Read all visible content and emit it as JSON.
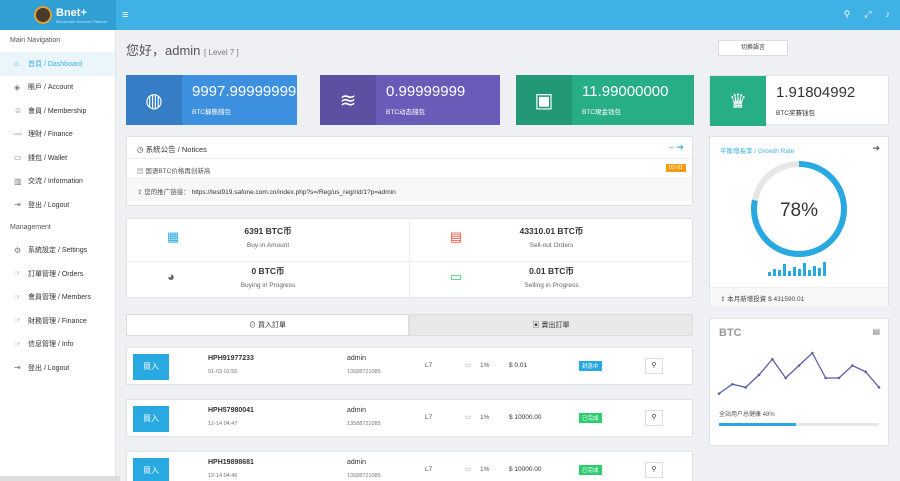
{
  "brand": {
    "name": "Bnet+",
    "subtitle": "Blockchain Network Platform"
  },
  "sidebar": {
    "sections": [
      {
        "title": "Main Navigation",
        "items": [
          {
            "label": "首頁 / Dashboard",
            "icon": "home-icon",
            "active": true
          },
          {
            "label": "賬戶 / Account",
            "icon": "layers-icon"
          },
          {
            "label": "會員 / Membership",
            "icon": "user-icon"
          },
          {
            "label": "理財 / Finance",
            "icon": "trend-icon"
          },
          {
            "label": "錢包 / Wallet",
            "icon": "folder-icon"
          },
          {
            "label": "交流 / Information",
            "icon": "book-icon"
          },
          {
            "label": "登出 / Logout",
            "icon": "logout-icon"
          }
        ]
      },
      {
        "title": "Management",
        "items": [
          {
            "label": "系統設定 / Settings",
            "icon": "settings-icon"
          },
          {
            "label": "訂單管理 / Orders",
            "icon": "hand-icon"
          },
          {
            "label": "會員管理 / Members",
            "icon": "hand-icon"
          },
          {
            "label": "財務管理 / Finance",
            "icon": "hand-icon"
          },
          {
            "label": "信息管理 / Info",
            "icon": "hand-icon"
          },
          {
            "label": "登出 / Logout",
            "icon": "logout-icon"
          }
        ]
      }
    ]
  },
  "header": {
    "greeting": "您好，admin",
    "level": "[ Level 7 ]",
    "switch_label": "切换語言"
  },
  "stats": [
    {
      "value": "9997.99999999",
      "label": "BTC靜態錢包",
      "color": "#3d8fe0",
      "icon": "globe-icon"
    },
    {
      "value": "0.99999999",
      "label": "BTC动态錢包",
      "color": "#6a5bb8",
      "icon": "stack-icon"
    },
    {
      "value": "11.99000000",
      "label": "BTC現金钱包",
      "color": "#27ae87",
      "icon": "wallet-icon"
    },
    {
      "value": "1.91804992",
      "label": "BTC奖賽钱包",
      "color": "#ffffff",
      "icon": "trophy-icon"
    }
  ],
  "notices": {
    "title": "系統公告 / Notices",
    "item": "国语BTC价格再创新高",
    "badge": "02-01",
    "link_label": "您的推广链接：",
    "link_url": "https://test919.safone.com.cn/index.php?s=/Reg/us_reg/rid/1?p=admin"
  },
  "summary": [
    {
      "amount": "6391 BTC币",
      "caption": "Buy-in Amount",
      "icon": "map-icon",
      "color": "#29a9e1"
    },
    {
      "amount": "43310.01 BTC币",
      "caption": "Sell-out Orders",
      "icon": "money-icon",
      "color": "#e74c3c"
    },
    {
      "amount": "0 BTC币",
      "caption": "Buying in Progress",
      "icon": "globe-small-icon",
      "color": "#666666"
    },
    {
      "amount": "0.01 BTC币",
      "caption": "Selling in Progress",
      "icon": "inbox-icon",
      "color": "#2ecc71"
    }
  ],
  "tabs": [
    {
      "label": "買入訂單"
    },
    {
      "label": "賣出訂單"
    }
  ],
  "orders": [
    {
      "button": "買入",
      "id": "HPH91977233",
      "time": "01-03 01:55",
      "user": "admin",
      "phone": "13588721085",
      "level": "L7",
      "pct": "1%",
      "price": "$ 0.01",
      "status": "封息中",
      "status_color": "#29a9e1"
    },
    {
      "button": "買入",
      "id": "HPH57980041",
      "time": "12-14 04:47",
      "user": "admin",
      "phone": "13588721085",
      "level": "L7",
      "pct": "1%",
      "price": "$ 10000.00",
      "status": "已完成",
      "status_color": "#2ecc71"
    },
    {
      "button": "買入",
      "id": "HPH19898681",
      "time": "12-14 04:46",
      "user": "admin",
      "phone": "13588721085",
      "level": "L7",
      "pct": "1%",
      "price": "$ 10000.00",
      "status": "已完成",
      "status_color": "#2ecc71"
    }
  ],
  "growth": {
    "title": "平衡增長率 / Growth Rate",
    "percent": "78%",
    "progress": 0.78,
    "footer": "本月新增投資 $ 431590.01",
    "bars": [
      4,
      7,
      6,
      12,
      5,
      9,
      7,
      13,
      6,
      10,
      8,
      14
    ]
  },
  "btc_widget": {
    "title": "BTC",
    "caption": "全站用户总健康 48%",
    "progress": 0.48,
    "line": [
      3,
      6,
      5,
      9,
      14,
      8,
      12,
      16,
      8,
      8,
      12,
      10,
      5
    ]
  }
}
